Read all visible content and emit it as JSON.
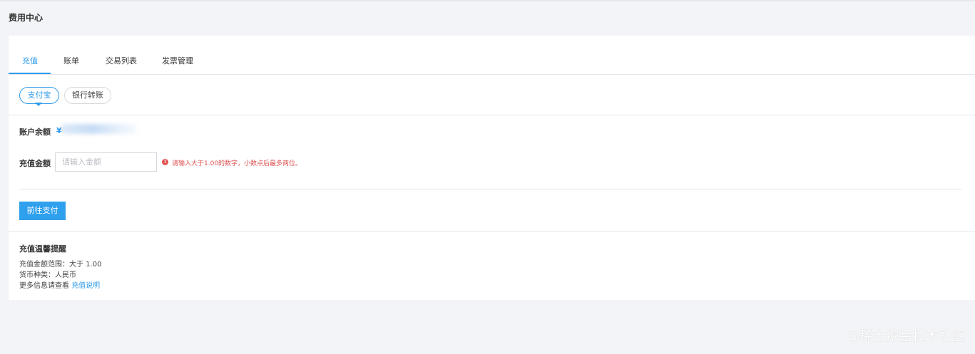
{
  "page": {
    "title": "费用中心"
  },
  "tabs": [
    {
      "label": "充值",
      "active": true
    },
    {
      "label": "账单",
      "active": false
    },
    {
      "label": "交易列表",
      "active": false
    },
    {
      "label": "发票管理",
      "active": false
    }
  ],
  "payment_methods": [
    {
      "label": "支付宝",
      "active": true
    },
    {
      "label": "银行转账",
      "active": false
    }
  ],
  "balance": {
    "label": "账户余额",
    "currency_symbol": "¥"
  },
  "recharge": {
    "label": "充值金额",
    "placeholder": "请输入金额",
    "value": "",
    "error": "请输入大于1.00的数字，小数点后最多两位。",
    "error_icon": "exclamation-circle-icon"
  },
  "pay_button": {
    "label": "前往支付"
  },
  "tips": {
    "title": "充值温馨提醒",
    "range": "充值金额范围：大于 1.00",
    "currency": "货币种类：人民币",
    "more_prefix": "更多信息请查看",
    "more_link": "充值说明"
  },
  "watermark": "@稀土掘金技术社区",
  "colors": {
    "accent": "#2f9bea",
    "error": "#e05252",
    "background": "#f3f4f7"
  }
}
